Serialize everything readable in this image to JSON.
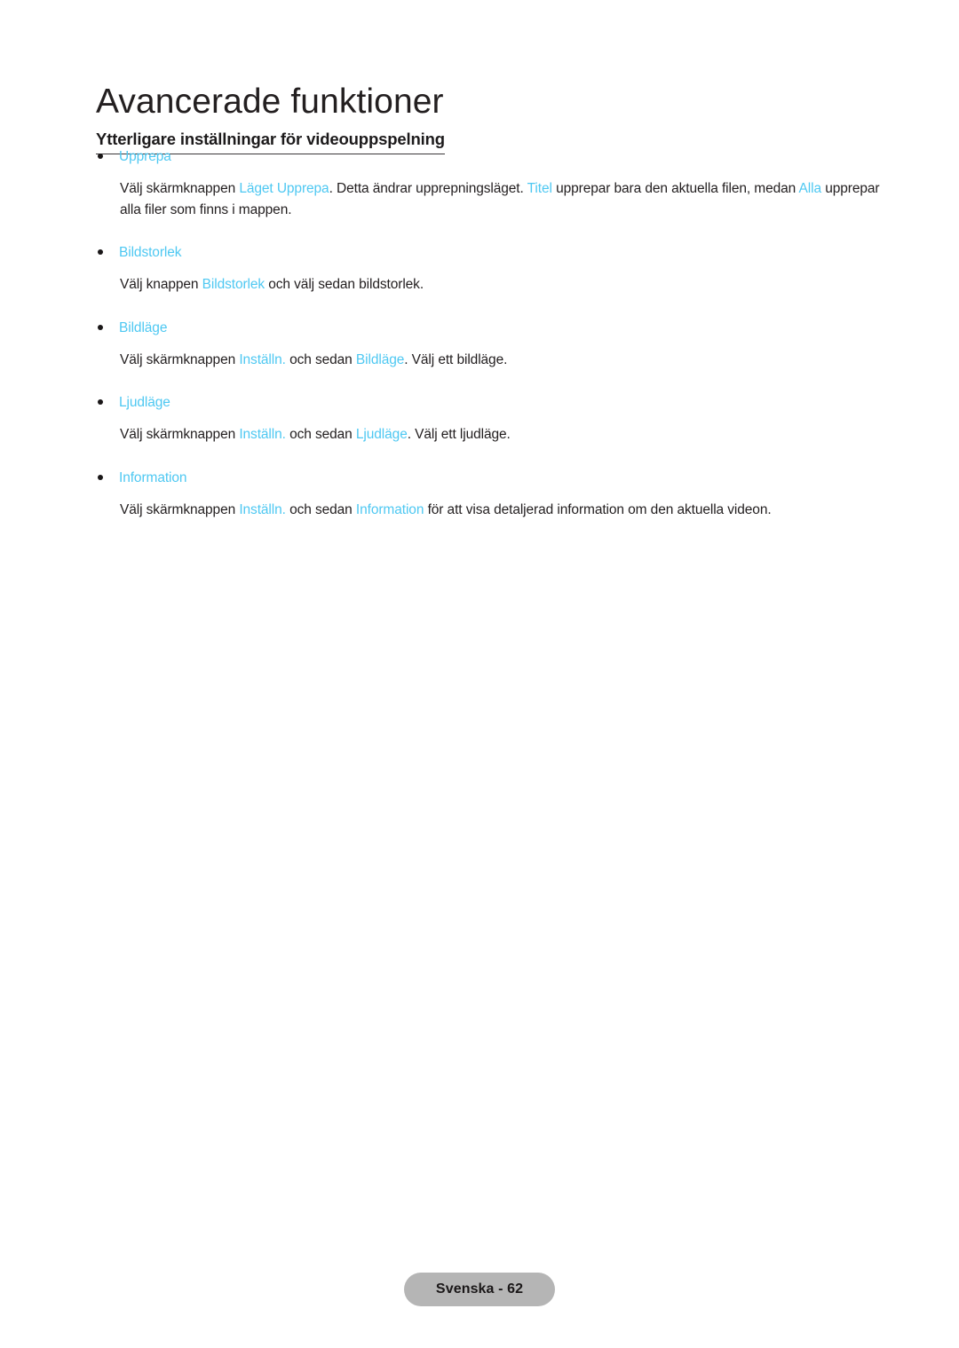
{
  "document": {
    "title": "Avancerade funktioner",
    "section_heading": "Ytterligare inställningar för videouppspelning",
    "accent_color": "#4ec8f2",
    "text_color": "#221e1f",
    "badge_color": "#b5b5b5"
  },
  "entries": [
    {
      "label": "Upprepa",
      "description_parts": [
        {
          "text": "Välj skärmknappen ",
          "link": false
        },
        {
          "text": "Läget Upprepa",
          "link": true
        },
        {
          "text": ". Detta ändrar upprepningsläget. ",
          "link": false
        },
        {
          "text": "Titel",
          "link": true
        },
        {
          "text": " upprepar bara den aktuella filen, medan ",
          "link": false
        },
        {
          "text": "Alla",
          "link": true
        },
        {
          "text": " upprepar alla filer som finns i mappen.",
          "link": false
        }
      ]
    },
    {
      "label": "Bildstorlek",
      "description_parts": [
        {
          "text": "Välj knappen ",
          "link": false
        },
        {
          "text": "Bildstorlek",
          "link": true
        },
        {
          "text": " och välj sedan bildstorlek.",
          "link": false
        }
      ]
    },
    {
      "label": "Bildläge",
      "description_parts": [
        {
          "text": "Välj skärmknappen ",
          "link": false
        },
        {
          "text": "Inställn.",
          "link": true
        },
        {
          "text": " och sedan ",
          "link": false
        },
        {
          "text": "Bildläge",
          "link": true
        },
        {
          "text": ". Välj ett bildläge.",
          "link": false
        }
      ]
    },
    {
      "label": "Ljudläge",
      "description_parts": [
        {
          "text": "Välj skärmknappen ",
          "link": false
        },
        {
          "text": "Inställn.",
          "link": true
        },
        {
          "text": " och sedan ",
          "link": false
        },
        {
          "text": "Ljudläge",
          "link": true
        },
        {
          "text": ". Välj ett ljudläge.",
          "link": false
        }
      ]
    },
    {
      "label": "Information",
      "description_parts": [
        {
          "text": "Välj skärmknappen ",
          "link": false
        },
        {
          "text": "Inställn.",
          "link": true
        },
        {
          "text": " och sedan ",
          "link": false
        },
        {
          "text": "Information",
          "link": true
        },
        {
          "text": " för att visa detaljerad information om den aktuella videon.",
          "link": false
        }
      ]
    }
  ],
  "footer": {
    "page_label": "Svenska - 62"
  }
}
